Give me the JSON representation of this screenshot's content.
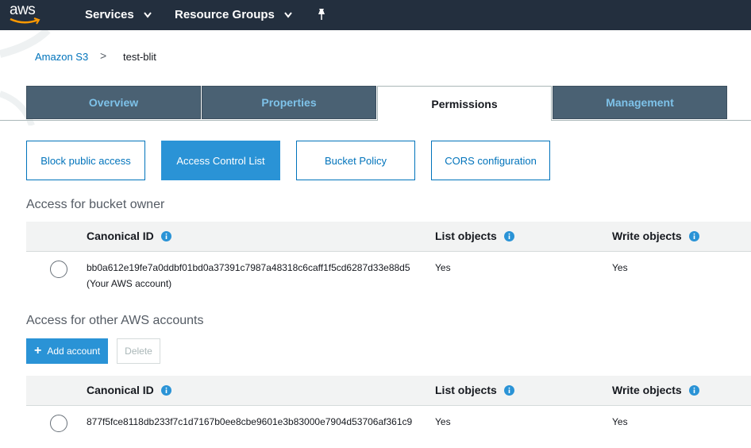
{
  "topnav": {
    "logo": "aws",
    "services": "Services",
    "resource_groups": "Resource Groups"
  },
  "breadcrumb": {
    "root": "Amazon S3",
    "separator": ">",
    "current": "test-blit"
  },
  "tabs": [
    "Overview",
    "Properties",
    "Permissions",
    "Management"
  ],
  "active_tab": "Permissions",
  "subtabs": [
    "Block public access",
    "Access Control List",
    "Bucket Policy",
    "CORS configuration"
  ],
  "active_subtab": "Access Control List",
  "owner_section": {
    "title": "Access for bucket owner",
    "columns": [
      "Canonical ID",
      "List objects",
      "Write objects"
    ],
    "row": {
      "canonical_id": "bb0a612e19fe7a0ddbf01bd0a37391c7987a48318c6caff1f5cd6287d33e88d5",
      "note": "(Your AWS account)",
      "list": "Yes",
      "write": "Yes"
    }
  },
  "other_section": {
    "title": "Access for other AWS accounts",
    "add_label": "Add account",
    "delete_label": "Delete",
    "columns": [
      "Canonical ID",
      "List objects",
      "Write objects"
    ],
    "row": {
      "canonical_id": "877f5fce8118db233f7c1d7167b0ee8cbe9601e3b83000e7904d53706af361c9",
      "list": "Yes",
      "write": "Yes"
    }
  },
  "colors": {
    "nav_bg": "#232f3e",
    "tab_bg": "#4a6173",
    "tab_text": "#7ec2e9",
    "link": "#0073bb",
    "primary": "#2a93d6",
    "aws_orange": "#ff9900"
  }
}
